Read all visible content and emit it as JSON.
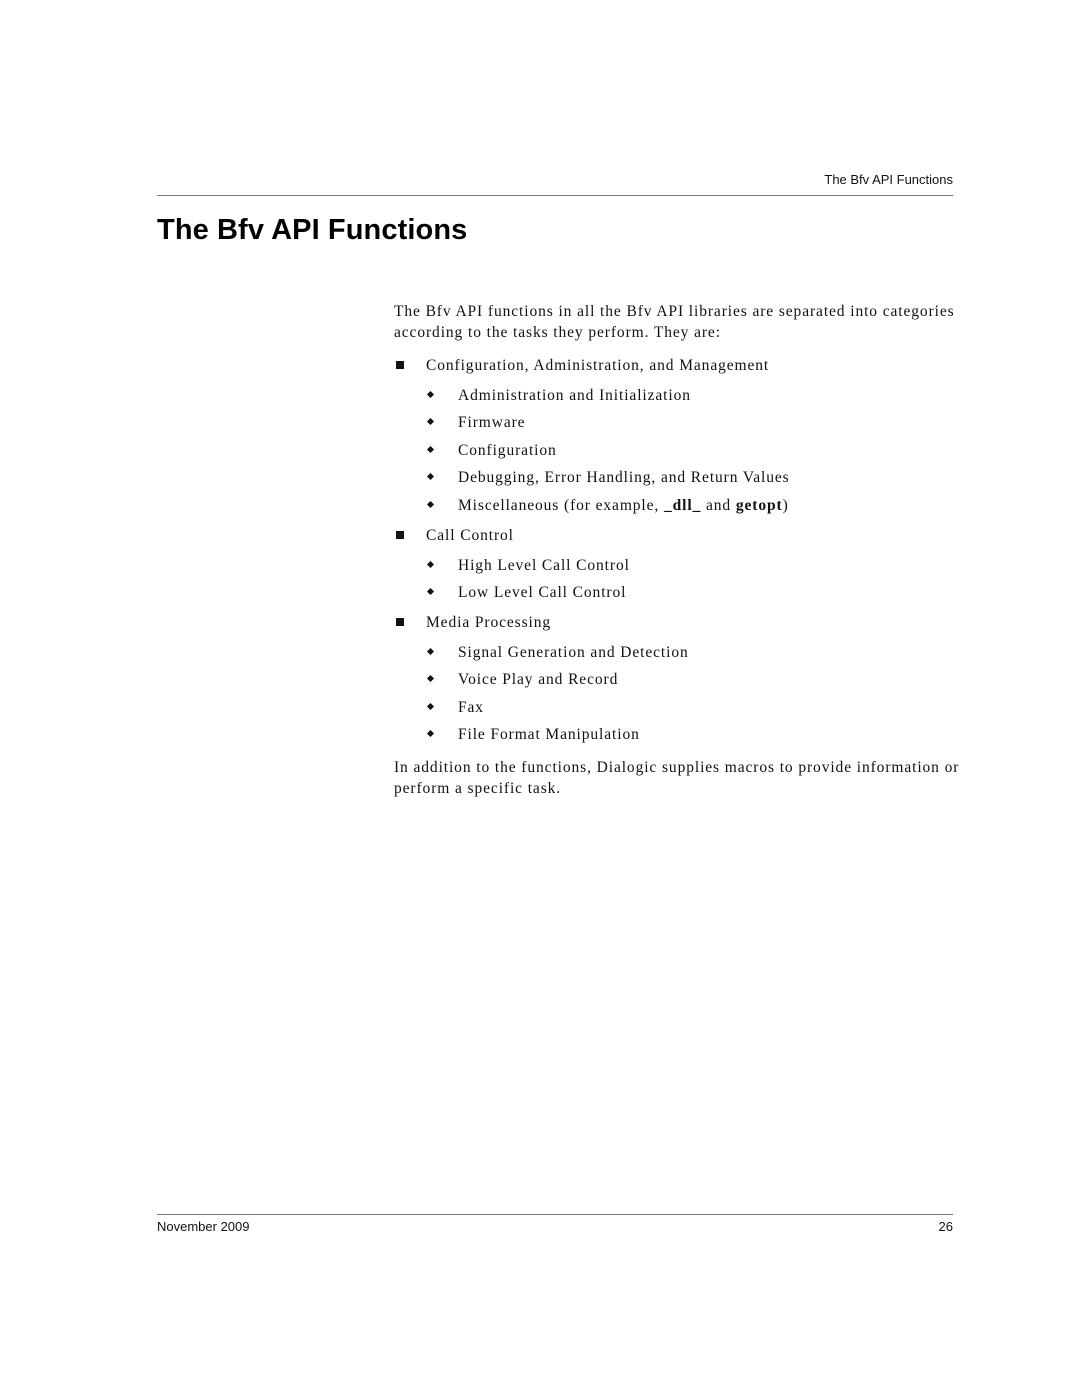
{
  "header": {
    "running_title": "The Bfv API Functions"
  },
  "title": "The Bfv API Functions",
  "intro": "The Bfv API functions in all the Bfv API libraries are separated into categories according to the tasks they perform. They are:",
  "categories": [
    {
      "label": "Configuration, Administration, and Management",
      "items": [
        "Administration and Initialization",
        "Firmware",
        "Configuration",
        "Debugging, Error Handling, and Return Values"
      ],
      "misc": {
        "prefix": "Miscellaneous (for example, ",
        "code1": "_dll_",
        "middle": " and ",
        "code2": "getopt",
        "suffix": ")"
      }
    },
    {
      "label": "Call Control",
      "items": [
        "High Level Call Control",
        "Low Level Call Control"
      ]
    },
    {
      "label": "Media Processing",
      "items": [
        "Signal Generation and Detection",
        "Voice Play and Record",
        "Fax",
        "File Format Manipulation"
      ]
    }
  ],
  "outro": "In addition to the functions, Dialogic supplies macros to provide information or perform a specific task.",
  "footer": {
    "date": "November 2009",
    "page_number": "26"
  }
}
